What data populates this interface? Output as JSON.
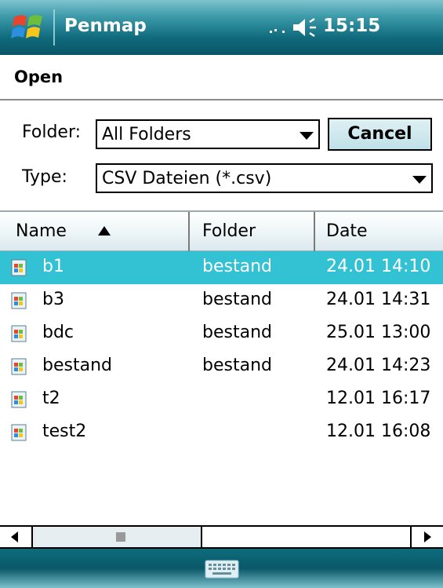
{
  "titlebar": {
    "app_title": "Penmap",
    "clock": "15:15",
    "icons": [
      "windows-start-icon",
      "signal-icon",
      "volume-icon"
    ]
  },
  "dialog": {
    "title": "Open",
    "folder_label": "Folder:",
    "folder_value": "All Folders",
    "type_label": "Type:",
    "type_value": "CSV Dateien (*.csv)",
    "cancel_label": "Cancel"
  },
  "list": {
    "columns": [
      "Name",
      "Folder",
      "Date"
    ],
    "sort": {
      "column": "Name",
      "direction": "ascending"
    },
    "rows": [
      {
        "name": "b1",
        "folder": "bestand",
        "date": "24.01 14:10",
        "selected": true
      },
      {
        "name": "b3",
        "folder": "bestand",
        "date": "24.01 14:31",
        "selected": false
      },
      {
        "name": "bdc",
        "folder": "bestand",
        "date": "25.01 13:00",
        "selected": false
      },
      {
        "name": "bestand",
        "folder": "bestand",
        "date": "24.01 14:23",
        "selected": false
      },
      {
        "name": "t2",
        "folder": "",
        "date": "12.01 16:17",
        "selected": false
      },
      {
        "name": "test2",
        "folder": "",
        "date": "12.01 16:08",
        "selected": false
      }
    ]
  },
  "colors": {
    "selection": "#33c1d4",
    "titlebar": "#0e6a7b"
  },
  "bottombar": {
    "icon": "keyboard-icon"
  }
}
